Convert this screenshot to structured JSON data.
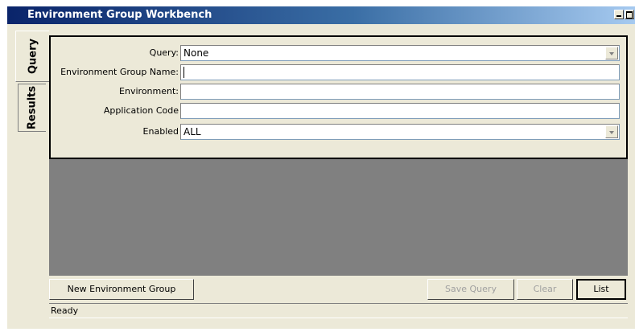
{
  "window": {
    "title": "Environment Group Workbench"
  },
  "tabs": [
    {
      "label": "Query",
      "active": true
    },
    {
      "label": "Results",
      "active": false
    }
  ],
  "form": {
    "query": {
      "label": "Query:",
      "value": "None"
    },
    "env_group_name": {
      "label": "Environment Group Name:",
      "value": ""
    },
    "environment": {
      "label": "Environment:",
      "value": ""
    },
    "application_code": {
      "label": "Application Code",
      "value": ""
    },
    "enabled": {
      "label": "Enabled",
      "value": "ALL"
    }
  },
  "buttons": {
    "new_env_group": "New Environment Group",
    "save_query": "Save Query",
    "clear": "Clear",
    "list": "List"
  },
  "status": "Ready",
  "colors": {
    "title_bar": "#0a246a",
    "background": "#ece9d8",
    "results_area": "#808080"
  }
}
